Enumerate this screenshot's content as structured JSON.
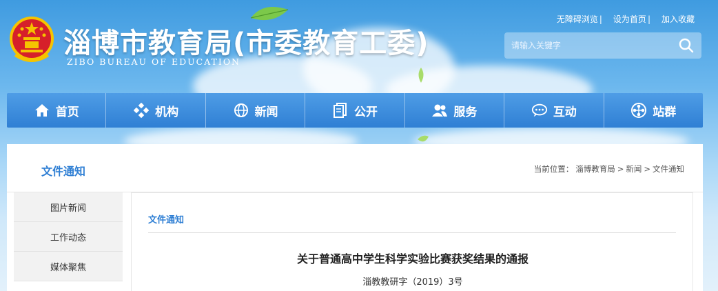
{
  "header": {
    "title": "淄博市教育局(市委教育工委)",
    "subtitle": "ZIBO BUREAU OF EDUCATION",
    "top_links": [
      "无障碍浏览",
      "设为首页",
      "加入收藏"
    ],
    "search": {
      "placeholder": "请输入关键字"
    }
  },
  "nav": {
    "items": [
      {
        "label": "首页",
        "icon": "home-icon"
      },
      {
        "label": "机构",
        "icon": "org-icon"
      },
      {
        "label": "新闻",
        "icon": "globe-icon"
      },
      {
        "label": "公开",
        "icon": "document-icon"
      },
      {
        "label": "服务",
        "icon": "people-icon"
      },
      {
        "label": "互动",
        "icon": "chat-icon"
      },
      {
        "label": "站群",
        "icon": "cluster-icon"
      }
    ]
  },
  "content": {
    "section_title": "文件通知",
    "breadcrumb": {
      "prefix": "当前位置：",
      "items": [
        "淄博教育局",
        "新闻",
        "文件通知"
      ],
      "separator": ">"
    },
    "sidebar": [
      "图片新闻",
      "工作动态",
      "媒体聚焦"
    ],
    "article": {
      "category": "文件通知",
      "title": "关于普通高中学生科学实验比赛获奖结果的通报",
      "doc_number": "淄教教研字（2019）3号"
    }
  },
  "colors": {
    "accent": "#2f7fd4",
    "nav_bg": "#3a8ddc"
  }
}
